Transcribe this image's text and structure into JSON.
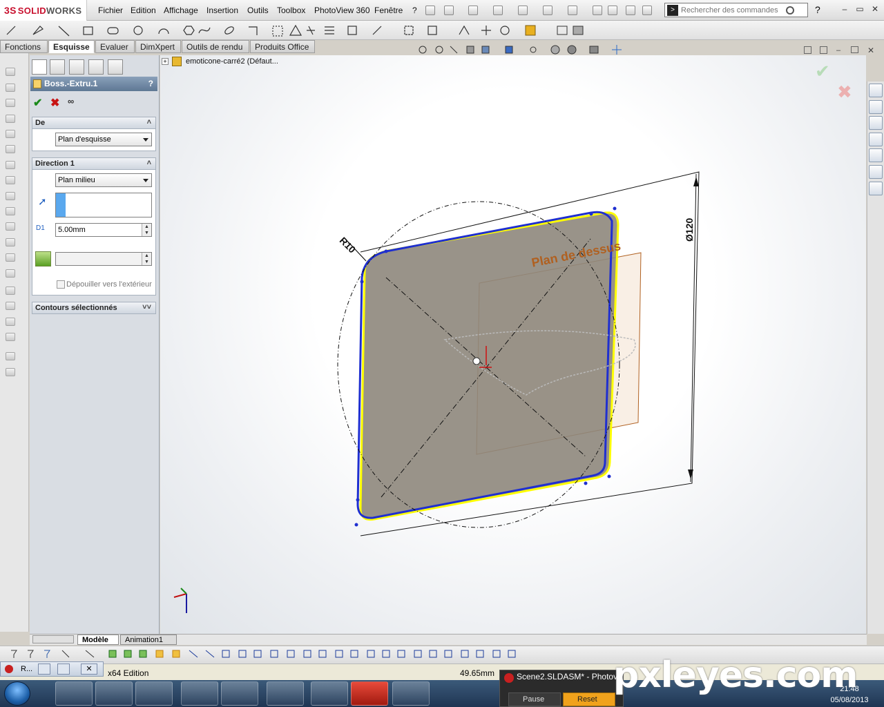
{
  "app": {
    "logo_ds": "3S",
    "logo_solid": "SOLID",
    "logo_works": "WORKS"
  },
  "menu": [
    "Fichier",
    "Edition",
    "Affichage",
    "Insertion",
    "Outils",
    "Toolbox",
    "PhotoView 360",
    "Fenêtre",
    "?"
  ],
  "search": {
    "placeholder": "Rechercher des commandes",
    "help": "?"
  },
  "cm_tabs": [
    "Fonctions",
    "Esquisse",
    "Evaluer",
    "DimXpert",
    "Outils de rendu",
    "Produits Office"
  ],
  "property_manager": {
    "title": "Boss.-Extru.1",
    "help": "?",
    "section_from": {
      "label": "De",
      "value": "Plan d'esquisse"
    },
    "section_dir1": {
      "label": "Direction 1",
      "end_condition": "Plan milieu",
      "depth": "5.00mm",
      "draft_label": "Dépouiller vers l'extérieur"
    },
    "section_contours": {
      "label": "Contours sélectionnés"
    }
  },
  "tree": {
    "root": "emoticone-carré2  (Défaut..."
  },
  "viewport": {
    "plane_label": "Plan de dessus",
    "dim_radius": "R10",
    "dim_diameter": "Ø120"
  },
  "bottom_tabs": [
    "Modèle",
    "Animation1"
  ],
  "mini_window": {
    "label": "R..."
  },
  "status": {
    "edition": "x64 Edition",
    "measure": "49.65mm"
  },
  "photoview": {
    "title": "Scene2.SLDASM* - Photov",
    "pause": "Pause",
    "reset": "Reset"
  },
  "clock": {
    "time": "21:48",
    "date": "05/08/2013"
  },
  "watermark": "pxleyes.com",
  "colors": {
    "accent_blue": "#1f2fd0",
    "selection_yellow": "#ffff00",
    "plane_orange": "#b06020",
    "title_blue": "#5e7894"
  }
}
